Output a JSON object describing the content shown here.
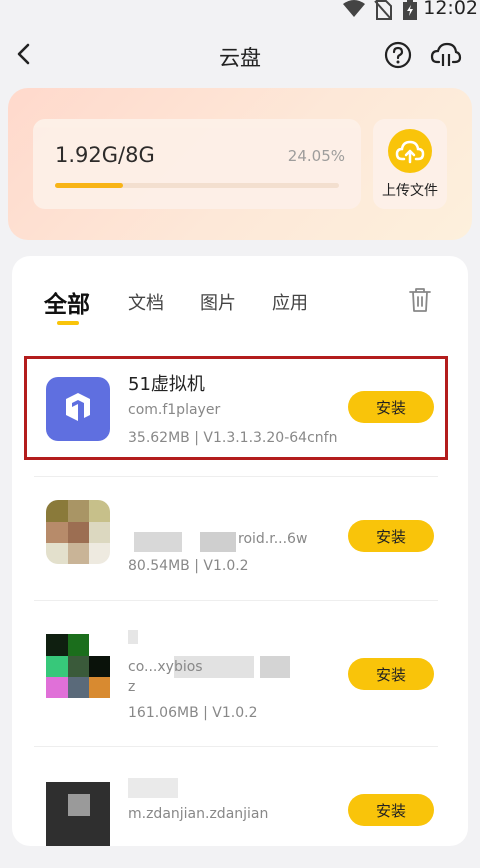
{
  "status_bar": {
    "time": "12:02"
  },
  "header": {
    "title": "云盘"
  },
  "storage": {
    "usage_text": "1.92G/8G",
    "percent_text": "24.05%",
    "percent_value": 24.05,
    "upload_label": "上传文件"
  },
  "tabs": [
    {
      "label": "全部",
      "active": true
    },
    {
      "label": "文档",
      "active": false
    },
    {
      "label": "图片",
      "active": false
    },
    {
      "label": "应用",
      "active": false
    }
  ],
  "apps": [
    {
      "name": "51虚拟机",
      "package": "com.f1player",
      "meta": "35.62MB | V1.3.1.3.20-64cnfn",
      "action": "安装"
    },
    {
      "name": "",
      "package": "roid.r...6w",
      "meta": "80.54MB | V1.0.2",
      "action": "安装"
    },
    {
      "name": "",
      "package": "co...xybios",
      "package_line2": "z",
      "meta": "161.06MB | V1.0.2",
      "action": "安装"
    },
    {
      "name": "",
      "package": "m.zdanjian.zdanjian",
      "meta": "",
      "action": "安装"
    }
  ],
  "colors": {
    "accent": "#f9c40a",
    "highlight_border": "#b31d1d",
    "app_icon_bg": "#5f6fe0"
  }
}
